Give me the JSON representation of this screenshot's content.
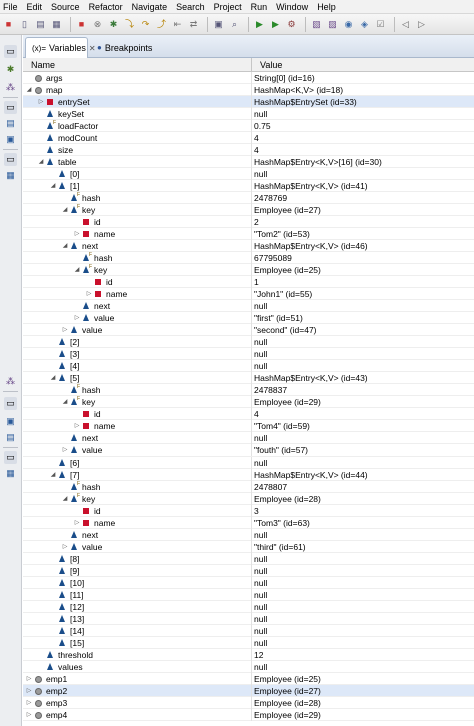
{
  "menubar": {
    "items": [
      "File",
      "Edit",
      "Source",
      "Refactor",
      "Navigate",
      "Search",
      "Project",
      "Run",
      "Window",
      "Help"
    ]
  },
  "toolbar": {
    "icons": [
      "terminate-icon",
      "new-icon",
      "save-icon",
      "print-icon",
      "stop-icon",
      "disconnect-icon",
      "debug-icon",
      "step-into-icon",
      "step-over-icon",
      "step-return-icon",
      "drop-frame-icon",
      "use-step-filters-icon",
      "open-console-icon",
      "search-icon",
      "run-icon",
      "coverage-icon",
      "external-tools-icon",
      "new-java-project-icon",
      "new-package-icon",
      "new-class-icon",
      "open-type-icon",
      "task-icon",
      "back-icon",
      "forward-icon"
    ]
  },
  "tabs": [
    {
      "label": "Variables",
      "icon": "(x)=",
      "active": true,
      "closeable": true
    },
    {
      "label": "Breakpoints",
      "icon": "●",
      "active": false,
      "closeable": false
    }
  ],
  "columns": {
    "name": "Name",
    "value": "Value"
  },
  "colors": {
    "selection": "#dde8f8",
    "protected_field": "#1a4d8a",
    "private_field": "#c9102c",
    "local_var": "#9a9a9a",
    "tab_bg": "#d5deeb"
  },
  "rows": [
    {
      "name": "args",
      "value": "String[0]  (id=16)",
      "indent": 0,
      "icon": "circ",
      "expander": "",
      "final": false
    },
    {
      "name": "map",
      "value": "HashMap<K,V>  (id=18)",
      "indent": 0,
      "icon": "circ",
      "expander": "down",
      "final": false
    },
    {
      "name": "entrySet",
      "value": "HashMap$EntrySet  (id=33)",
      "indent": 1,
      "icon": "sq",
      "expander": "right",
      "final": false,
      "selected": true
    },
    {
      "name": "keySet",
      "value": "null",
      "indent": 1,
      "icon": "tri",
      "expander": "",
      "final": false
    },
    {
      "name": "loadFactor",
      "value": "0.75",
      "indent": 1,
      "icon": "tri",
      "expander": "",
      "final": true
    },
    {
      "name": "modCount",
      "value": "4",
      "indent": 1,
      "icon": "tri",
      "expander": "",
      "final": false
    },
    {
      "name": "size",
      "value": "4",
      "indent": 1,
      "icon": "tri",
      "expander": "",
      "final": false
    },
    {
      "name": "table",
      "value": "HashMap$Entry<K,V>[16]  (id=30)",
      "indent": 1,
      "icon": "tri",
      "expander": "down",
      "final": false
    },
    {
      "name": "[0]",
      "value": "null",
      "indent": 2,
      "icon": "tri",
      "expander": "",
      "final": false
    },
    {
      "name": "[1]",
      "value": "HashMap$Entry<K,V>  (id=41)",
      "indent": 2,
      "icon": "tri",
      "expander": "down",
      "final": false
    },
    {
      "name": "hash",
      "value": "2478769",
      "indent": 3,
      "icon": "tri",
      "expander": "",
      "final": true
    },
    {
      "name": "key",
      "value": "Employee  (id=27)",
      "indent": 3,
      "icon": "tri",
      "expander": "down",
      "final": true
    },
    {
      "name": "id",
      "value": "2",
      "indent": 4,
      "icon": "sq",
      "expander": "",
      "final": false
    },
    {
      "name": "name",
      "value": "\"Tom2\" (id=53)",
      "indent": 4,
      "icon": "sq",
      "expander": "right",
      "final": false
    },
    {
      "name": "next",
      "value": "HashMap$Entry<K,V>  (id=46)",
      "indent": 3,
      "icon": "tri",
      "expander": "down",
      "final": false
    },
    {
      "name": "hash",
      "value": "67795089",
      "indent": 4,
      "icon": "tri",
      "expander": "",
      "final": true
    },
    {
      "name": "key",
      "value": "Employee  (id=25)",
      "indent": 4,
      "icon": "tri",
      "expander": "down",
      "final": true
    },
    {
      "name": "id",
      "value": "1",
      "indent": 5,
      "icon": "sq",
      "expander": "",
      "final": false
    },
    {
      "name": "name",
      "value": "\"John1\" (id=55)",
      "indent": 5,
      "icon": "sq",
      "expander": "right",
      "final": false
    },
    {
      "name": "next",
      "value": "null",
      "indent": 4,
      "icon": "tri",
      "expander": "",
      "final": false
    },
    {
      "name": "value",
      "value": "\"first\" (id=51)",
      "indent": 4,
      "icon": "tri",
      "expander": "right",
      "final": false
    },
    {
      "name": "value",
      "value": "\"second\" (id=47)",
      "indent": 3,
      "icon": "tri",
      "expander": "right",
      "final": false
    },
    {
      "name": "[2]",
      "value": "null",
      "indent": 2,
      "icon": "tri",
      "expander": "",
      "final": false
    },
    {
      "name": "[3]",
      "value": "null",
      "indent": 2,
      "icon": "tri",
      "expander": "",
      "final": false
    },
    {
      "name": "[4]",
      "value": "null",
      "indent": 2,
      "icon": "tri",
      "expander": "",
      "final": false
    },
    {
      "name": "[5]",
      "value": "HashMap$Entry<K,V>  (id=43)",
      "indent": 2,
      "icon": "tri",
      "expander": "down",
      "final": false
    },
    {
      "name": "hash",
      "value": "2478837",
      "indent": 3,
      "icon": "tri",
      "expander": "",
      "final": true
    },
    {
      "name": "key",
      "value": "Employee  (id=29)",
      "indent": 3,
      "icon": "tri",
      "expander": "down",
      "final": true
    },
    {
      "name": "id",
      "value": "4",
      "indent": 4,
      "icon": "sq",
      "expander": "",
      "final": false
    },
    {
      "name": "name",
      "value": "\"Tom4\" (id=59)",
      "indent": 4,
      "icon": "sq",
      "expander": "right",
      "final": false
    },
    {
      "name": "next",
      "value": "null",
      "indent": 3,
      "icon": "tri",
      "expander": "",
      "final": false
    },
    {
      "name": "value",
      "value": "\"fouth\" (id=57)",
      "indent": 3,
      "icon": "tri",
      "expander": "right",
      "final": false
    },
    {
      "name": "[6]",
      "value": "null",
      "indent": 2,
      "icon": "tri",
      "expander": "",
      "final": false
    },
    {
      "name": "[7]",
      "value": "HashMap$Entry<K,V>  (id=44)",
      "indent": 2,
      "icon": "tri",
      "expander": "down",
      "final": false
    },
    {
      "name": "hash",
      "value": "2478807",
      "indent": 3,
      "icon": "tri",
      "expander": "",
      "final": true
    },
    {
      "name": "key",
      "value": "Employee  (id=28)",
      "indent": 3,
      "icon": "tri",
      "expander": "down",
      "final": true
    },
    {
      "name": "id",
      "value": "3",
      "indent": 4,
      "icon": "sq",
      "expander": "",
      "final": false
    },
    {
      "name": "name",
      "value": "\"Tom3\" (id=63)",
      "indent": 4,
      "icon": "sq",
      "expander": "right",
      "final": false
    },
    {
      "name": "next",
      "value": "null",
      "indent": 3,
      "icon": "tri",
      "expander": "",
      "final": false
    },
    {
      "name": "value",
      "value": "\"third\" (id=61)",
      "indent": 3,
      "icon": "tri",
      "expander": "right",
      "final": false
    },
    {
      "name": "[8]",
      "value": "null",
      "indent": 2,
      "icon": "tri",
      "expander": "",
      "final": false
    },
    {
      "name": "[9]",
      "value": "null",
      "indent": 2,
      "icon": "tri",
      "expander": "",
      "final": false
    },
    {
      "name": "[10]",
      "value": "null",
      "indent": 2,
      "icon": "tri",
      "expander": "",
      "final": false
    },
    {
      "name": "[11]",
      "value": "null",
      "indent": 2,
      "icon": "tri",
      "expander": "",
      "final": false
    },
    {
      "name": "[12]",
      "value": "null",
      "indent": 2,
      "icon": "tri",
      "expander": "",
      "final": false
    },
    {
      "name": "[13]",
      "value": "null",
      "indent": 2,
      "icon": "tri",
      "expander": "",
      "final": false
    },
    {
      "name": "[14]",
      "value": "null",
      "indent": 2,
      "icon": "tri",
      "expander": "",
      "final": false
    },
    {
      "name": "[15]",
      "value": "null",
      "indent": 2,
      "icon": "tri",
      "expander": "",
      "final": false
    },
    {
      "name": "threshold",
      "value": "12",
      "indent": 1,
      "icon": "tri",
      "expander": "",
      "final": false
    },
    {
      "name": "values",
      "value": "null",
      "indent": 1,
      "icon": "tri",
      "expander": "",
      "final": false
    },
    {
      "name": "emp1",
      "value": "Employee  (id=25)",
      "indent": 0,
      "icon": "circ",
      "expander": "right",
      "final": false
    },
    {
      "name": "emp2",
      "value": "Employee  (id=27)",
      "indent": 0,
      "icon": "circ",
      "expander": "right",
      "final": false,
      "selected": true
    },
    {
      "name": "emp3",
      "value": "Employee  (id=28)",
      "indent": 0,
      "icon": "circ",
      "expander": "right",
      "final": false
    },
    {
      "name": "emp4",
      "value": "Employee  (id=29)",
      "indent": 0,
      "icon": "circ",
      "expander": "right",
      "final": false
    }
  ]
}
